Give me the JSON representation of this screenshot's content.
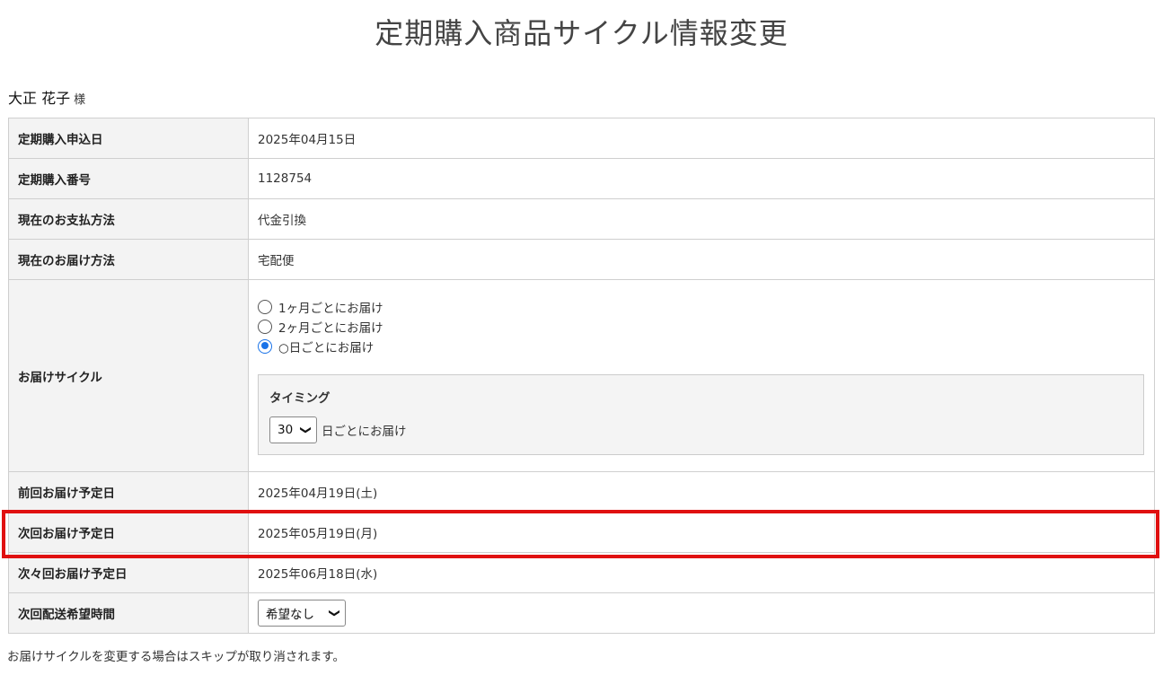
{
  "page": {
    "title": "定期購入商品サイクル情報変更"
  },
  "customer": {
    "name": "大正 花子",
    "honorific": "様"
  },
  "rows": {
    "apply_date": {
      "label": "定期購入申込日",
      "value": "2025年04月15日"
    },
    "order_number": {
      "label": "定期購入番号",
      "value": "1128754"
    },
    "payment": {
      "label": "現在のお支払方法",
      "value": "代金引換"
    },
    "delivery_method": {
      "label": "現在のお届け方法",
      "value": "宅配便"
    },
    "cycle": {
      "label": "お届けサイクル",
      "options": [
        {
          "label": "1ヶ月ごとにお届け",
          "checked": false
        },
        {
          "label": "2ヶ月ごとにお届け",
          "checked": false
        },
        {
          "label": "○日ごとにお届け",
          "checked": true
        }
      ],
      "timing": {
        "title": "タイミング",
        "selected_days": "30",
        "suffix": "日ごとにお届け"
      }
    },
    "prev_date": {
      "label": "前回お届け予定日",
      "value": "2025年04月19日(土)"
    },
    "next_date": {
      "label": "次回お届け予定日",
      "value": "2025年05月19日(月)"
    },
    "next_next_date": {
      "label": "次々回お届け予定日",
      "value": "2025年06月18日(水)"
    },
    "delivery_time": {
      "label": "次回配送希望時間",
      "selected": "希望なし"
    }
  },
  "footnote": "お届けサイクルを変更する場合はスキップが取り消されます。",
  "colors": {
    "highlight": "#e01010",
    "radio_checked": "#1a73e8",
    "label_bg": "#f3f3f3"
  },
  "icons": {
    "select_arrow": "chevron-down-icon",
    "radio": "radio-button-icon"
  }
}
